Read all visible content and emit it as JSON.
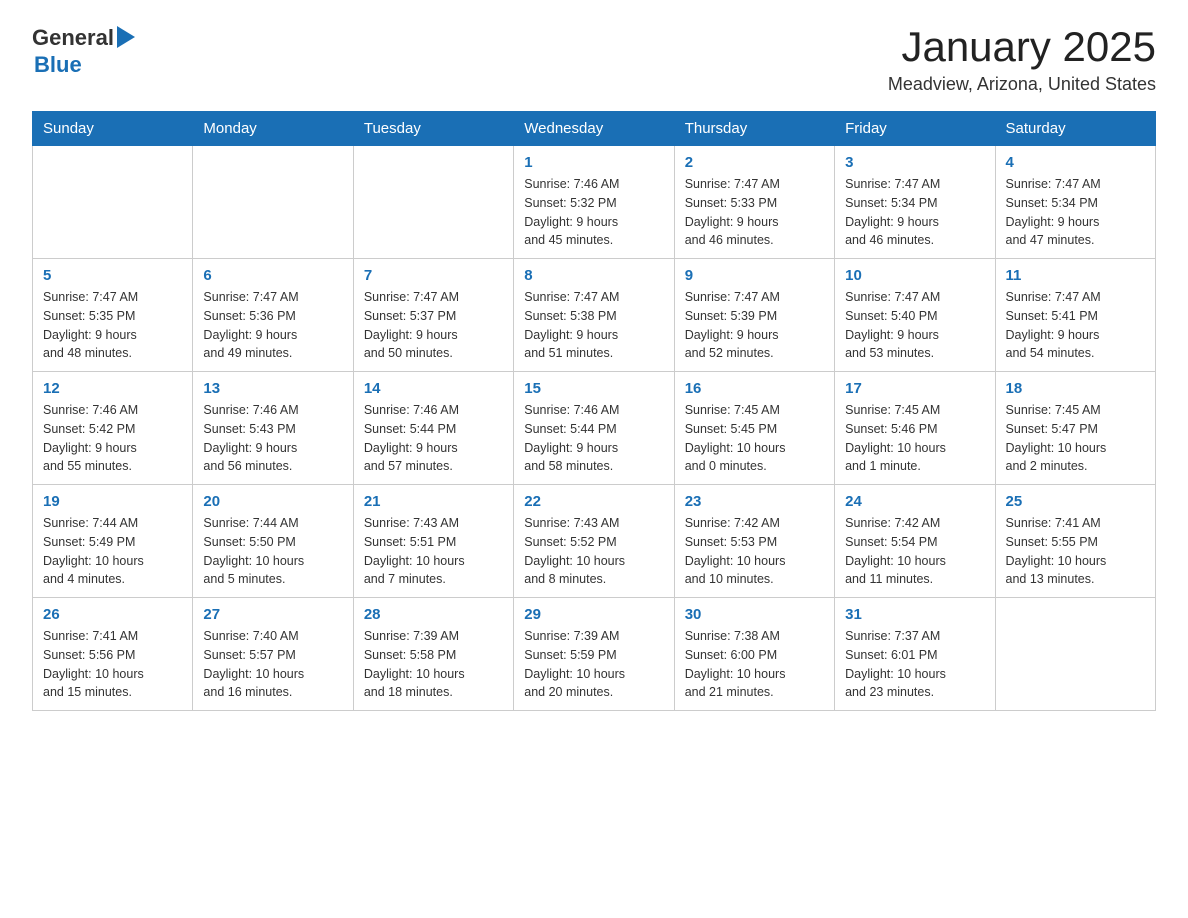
{
  "header": {
    "logo_general": "General",
    "logo_blue": "Blue",
    "title": "January 2025",
    "subtitle": "Meadview, Arizona, United States"
  },
  "weekdays": [
    "Sunday",
    "Monday",
    "Tuesday",
    "Wednesday",
    "Thursday",
    "Friday",
    "Saturday"
  ],
  "weeks": [
    [
      {
        "day": "",
        "info": ""
      },
      {
        "day": "",
        "info": ""
      },
      {
        "day": "",
        "info": ""
      },
      {
        "day": "1",
        "info": "Sunrise: 7:46 AM\nSunset: 5:32 PM\nDaylight: 9 hours\nand 45 minutes."
      },
      {
        "day": "2",
        "info": "Sunrise: 7:47 AM\nSunset: 5:33 PM\nDaylight: 9 hours\nand 46 minutes."
      },
      {
        "day": "3",
        "info": "Sunrise: 7:47 AM\nSunset: 5:34 PM\nDaylight: 9 hours\nand 46 minutes."
      },
      {
        "day": "4",
        "info": "Sunrise: 7:47 AM\nSunset: 5:34 PM\nDaylight: 9 hours\nand 47 minutes."
      }
    ],
    [
      {
        "day": "5",
        "info": "Sunrise: 7:47 AM\nSunset: 5:35 PM\nDaylight: 9 hours\nand 48 minutes."
      },
      {
        "day": "6",
        "info": "Sunrise: 7:47 AM\nSunset: 5:36 PM\nDaylight: 9 hours\nand 49 minutes."
      },
      {
        "day": "7",
        "info": "Sunrise: 7:47 AM\nSunset: 5:37 PM\nDaylight: 9 hours\nand 50 minutes."
      },
      {
        "day": "8",
        "info": "Sunrise: 7:47 AM\nSunset: 5:38 PM\nDaylight: 9 hours\nand 51 minutes."
      },
      {
        "day": "9",
        "info": "Sunrise: 7:47 AM\nSunset: 5:39 PM\nDaylight: 9 hours\nand 52 minutes."
      },
      {
        "day": "10",
        "info": "Sunrise: 7:47 AM\nSunset: 5:40 PM\nDaylight: 9 hours\nand 53 minutes."
      },
      {
        "day": "11",
        "info": "Sunrise: 7:47 AM\nSunset: 5:41 PM\nDaylight: 9 hours\nand 54 minutes."
      }
    ],
    [
      {
        "day": "12",
        "info": "Sunrise: 7:46 AM\nSunset: 5:42 PM\nDaylight: 9 hours\nand 55 minutes."
      },
      {
        "day": "13",
        "info": "Sunrise: 7:46 AM\nSunset: 5:43 PM\nDaylight: 9 hours\nand 56 minutes."
      },
      {
        "day": "14",
        "info": "Sunrise: 7:46 AM\nSunset: 5:44 PM\nDaylight: 9 hours\nand 57 minutes."
      },
      {
        "day": "15",
        "info": "Sunrise: 7:46 AM\nSunset: 5:44 PM\nDaylight: 9 hours\nand 58 minutes."
      },
      {
        "day": "16",
        "info": "Sunrise: 7:45 AM\nSunset: 5:45 PM\nDaylight: 10 hours\nand 0 minutes."
      },
      {
        "day": "17",
        "info": "Sunrise: 7:45 AM\nSunset: 5:46 PM\nDaylight: 10 hours\nand 1 minute."
      },
      {
        "day": "18",
        "info": "Sunrise: 7:45 AM\nSunset: 5:47 PM\nDaylight: 10 hours\nand 2 minutes."
      }
    ],
    [
      {
        "day": "19",
        "info": "Sunrise: 7:44 AM\nSunset: 5:49 PM\nDaylight: 10 hours\nand 4 minutes."
      },
      {
        "day": "20",
        "info": "Sunrise: 7:44 AM\nSunset: 5:50 PM\nDaylight: 10 hours\nand 5 minutes."
      },
      {
        "day": "21",
        "info": "Sunrise: 7:43 AM\nSunset: 5:51 PM\nDaylight: 10 hours\nand 7 minutes."
      },
      {
        "day": "22",
        "info": "Sunrise: 7:43 AM\nSunset: 5:52 PM\nDaylight: 10 hours\nand 8 minutes."
      },
      {
        "day": "23",
        "info": "Sunrise: 7:42 AM\nSunset: 5:53 PM\nDaylight: 10 hours\nand 10 minutes."
      },
      {
        "day": "24",
        "info": "Sunrise: 7:42 AM\nSunset: 5:54 PM\nDaylight: 10 hours\nand 11 minutes."
      },
      {
        "day": "25",
        "info": "Sunrise: 7:41 AM\nSunset: 5:55 PM\nDaylight: 10 hours\nand 13 minutes."
      }
    ],
    [
      {
        "day": "26",
        "info": "Sunrise: 7:41 AM\nSunset: 5:56 PM\nDaylight: 10 hours\nand 15 minutes."
      },
      {
        "day": "27",
        "info": "Sunrise: 7:40 AM\nSunset: 5:57 PM\nDaylight: 10 hours\nand 16 minutes."
      },
      {
        "day": "28",
        "info": "Sunrise: 7:39 AM\nSunset: 5:58 PM\nDaylight: 10 hours\nand 18 minutes."
      },
      {
        "day": "29",
        "info": "Sunrise: 7:39 AM\nSunset: 5:59 PM\nDaylight: 10 hours\nand 20 minutes."
      },
      {
        "day": "30",
        "info": "Sunrise: 7:38 AM\nSunset: 6:00 PM\nDaylight: 10 hours\nand 21 minutes."
      },
      {
        "day": "31",
        "info": "Sunrise: 7:37 AM\nSunset: 6:01 PM\nDaylight: 10 hours\nand 23 minutes."
      },
      {
        "day": "",
        "info": ""
      }
    ]
  ]
}
